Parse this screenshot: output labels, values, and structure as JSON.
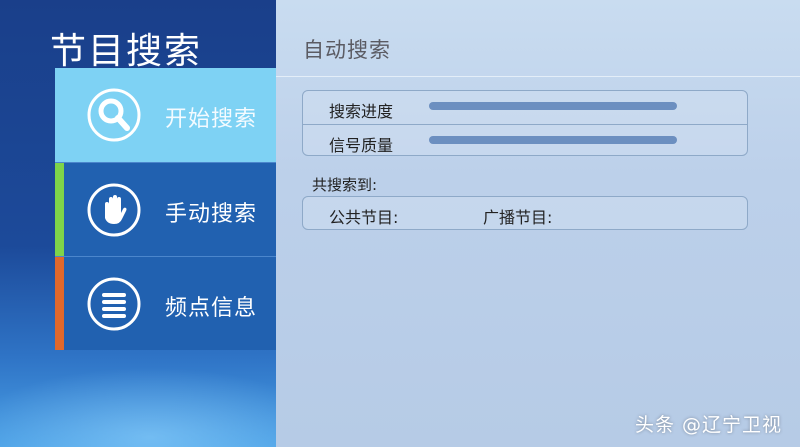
{
  "sidebar": {
    "title": "节目搜索",
    "items": [
      {
        "label": "开始搜索",
        "icon": "magnifier-icon",
        "active": true,
        "accent": ""
      },
      {
        "label": "手动搜索",
        "icon": "hand-icon",
        "active": false,
        "accent": "#7ed44a"
      },
      {
        "label": "频点信息",
        "icon": "list-icon",
        "active": false,
        "accent": "#e0682c"
      }
    ]
  },
  "main": {
    "title": "自动搜索",
    "progress": {
      "search_label": "搜索进度",
      "signal_label": "信号质量"
    },
    "found": {
      "label": "共搜索到:",
      "public_label": "公共节目:",
      "broadcast_label": "广播节目:"
    }
  },
  "watermark": "头条 @辽宁卫视",
  "colors": {
    "sidebar_bg": "#1c4a9a",
    "active_item": "#7ed2f4",
    "panel_bg": "#bcd0ea",
    "bar": "#6c8fc0"
  }
}
